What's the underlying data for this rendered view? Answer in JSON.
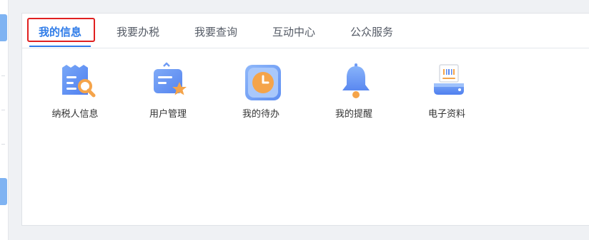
{
  "tabs": [
    {
      "label": "我的信息",
      "active": true
    },
    {
      "label": "我要办税",
      "active": false
    },
    {
      "label": "我要查询",
      "active": false
    },
    {
      "label": "互动中心",
      "active": false
    },
    {
      "label": "公众服务",
      "active": false
    }
  ],
  "items": [
    {
      "label": "纳税人信息",
      "icon": "taxpayer-info-icon"
    },
    {
      "label": "用户管理",
      "icon": "user-management-icon"
    },
    {
      "label": "我的待办",
      "icon": "clock-icon"
    },
    {
      "label": "我的提醒",
      "icon": "bell-icon"
    },
    {
      "label": "电子资料",
      "icon": "printer-icon"
    }
  ],
  "colors": {
    "accent": "#2f7ce8",
    "highlight": "#e02020"
  }
}
